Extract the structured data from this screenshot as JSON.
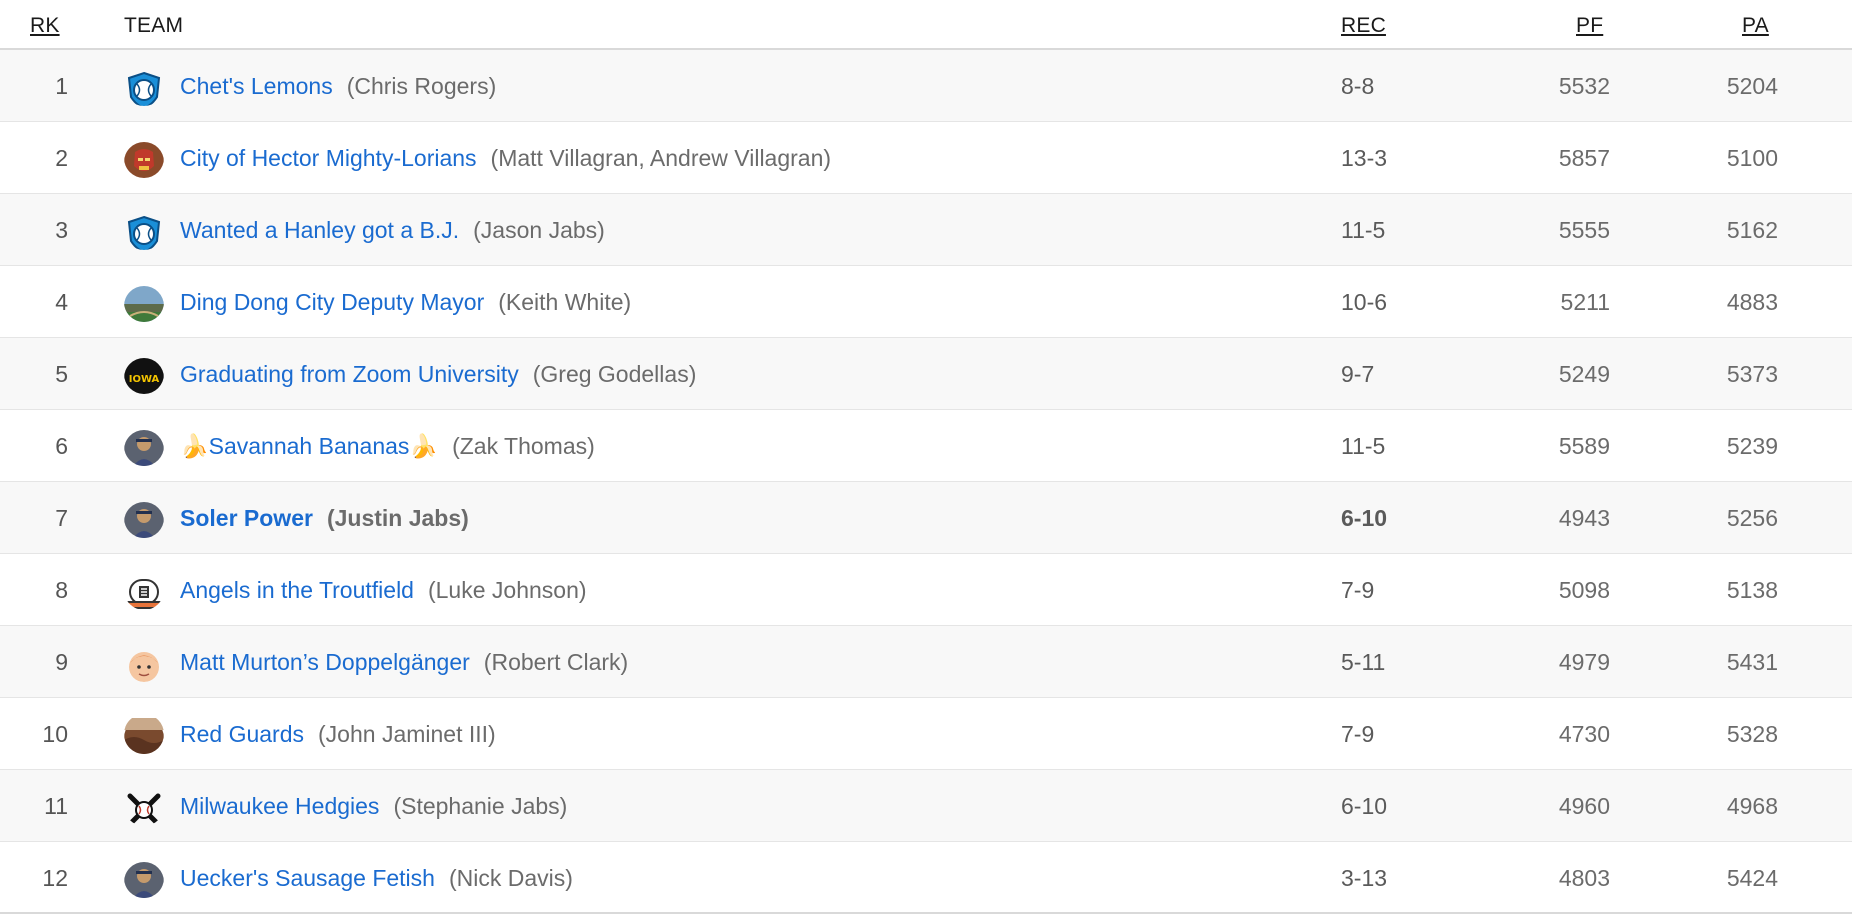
{
  "headers": {
    "rk": "RK",
    "team": "TEAM",
    "rec": "REC",
    "pf": "PF",
    "pa": "PA"
  },
  "rows": [
    {
      "rank": "1",
      "team": "Chet's Lemons",
      "owner": "(Chris Rogers)",
      "rec": "8-8",
      "pf": "5532",
      "pa": "5204",
      "avatar": "shield-baseball-icon"
    },
    {
      "rank": "2",
      "team": "City of Hector Mighty-Lorians",
      "owner": "(Matt Villagran, Andrew Villagran)",
      "rec": "13-3",
      "pf": "5857",
      "pa": "5100",
      "avatar": "ironman-avatar"
    },
    {
      "rank": "3",
      "team": "Wanted a Hanley got a B.J.",
      "owner": "(Jason Jabs)",
      "rec": "11-5",
      "pf": "5555",
      "pa": "5162",
      "avatar": "shield-baseball-icon"
    },
    {
      "rank": "4",
      "team": "Ding Dong City Deputy Mayor",
      "owner": "(Keith White)",
      "rec": "10-6",
      "pf": "5211",
      "pa": "4883",
      "avatar": "stadium-photo-avatar"
    },
    {
      "rank": "5",
      "team": "Graduating from Zoom University",
      "owner": "(Greg Godellas)",
      "rec": "9-7",
      "pf": "5249",
      "pa": "5373",
      "avatar": "iowa-logo-avatar"
    },
    {
      "rank": "6",
      "team": "🍌Savannah Bananas🍌",
      "owner": "(Zak Thomas)",
      "rec": "11-5",
      "pf": "5589",
      "pa": "5239",
      "avatar": "player-photo-avatar"
    },
    {
      "rank": "7",
      "team": "Soler Power",
      "owner": "(Justin Jabs)",
      "rec": "6-10",
      "pf": "4943",
      "pa": "5256",
      "avatar": "player-photo-avatar",
      "highlight": true
    },
    {
      "rank": "8",
      "team": "Angels in the Troutfield",
      "owner": "(Luke Johnson)",
      "rec": "7-9",
      "pf": "5098",
      "pa": "5138",
      "avatar": "cap-icon"
    },
    {
      "rank": "9",
      "team": "Matt Murton’s Doppelgänger",
      "owner": "(Robert Clark)",
      "rec": "5-11",
      "pf": "4979",
      "pa": "5431",
      "avatar": "face-emoji-avatar"
    },
    {
      "rank": "10",
      "team": "Red Guards",
      "owner": "(John Jaminet III)",
      "rec": "7-9",
      "pf": "4730",
      "pa": "5328",
      "avatar": "crowd-photo-avatar"
    },
    {
      "rank": "11",
      "team": "Milwaukee Hedgies",
      "owner": "(Stephanie Jabs)",
      "rec": "6-10",
      "pf": "4960",
      "pa": "4968",
      "avatar": "crossed-bats-icon"
    },
    {
      "rank": "12",
      "team": "Uecker's Sausage Fetish",
      "owner": "(Nick Davis)",
      "rec": "3-13",
      "pf": "4803",
      "pa": "5424",
      "avatar": "player-photo-avatar"
    }
  ],
  "colors": {
    "link": "#1a6bd0",
    "muted": "#6b6b6b",
    "stripe": "#f8f8f8"
  }
}
